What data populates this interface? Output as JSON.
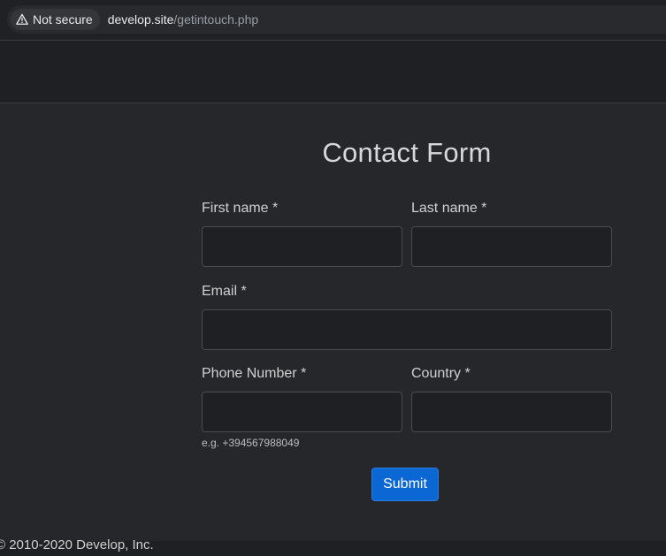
{
  "browser": {
    "security_label": "Not secure",
    "url_host": "develop.site",
    "url_path": "/getintouch.php"
  },
  "form": {
    "title": "Contact Form",
    "first_name_label": "First name *",
    "first_name_value": "",
    "last_name_label": "Last name *",
    "last_name_value": "",
    "email_label": "Email *",
    "email_value": "",
    "phone_label": "Phone Number *",
    "phone_value": "",
    "phone_help": "e.g. +394567988049",
    "country_label": "Country *",
    "country_value": "",
    "submit_label": "Submit"
  },
  "footer": {
    "copyright": "© 2010-2020 Develop, Inc."
  },
  "colors": {
    "page_bg": "#25272a",
    "accent": "#0b67d4"
  }
}
